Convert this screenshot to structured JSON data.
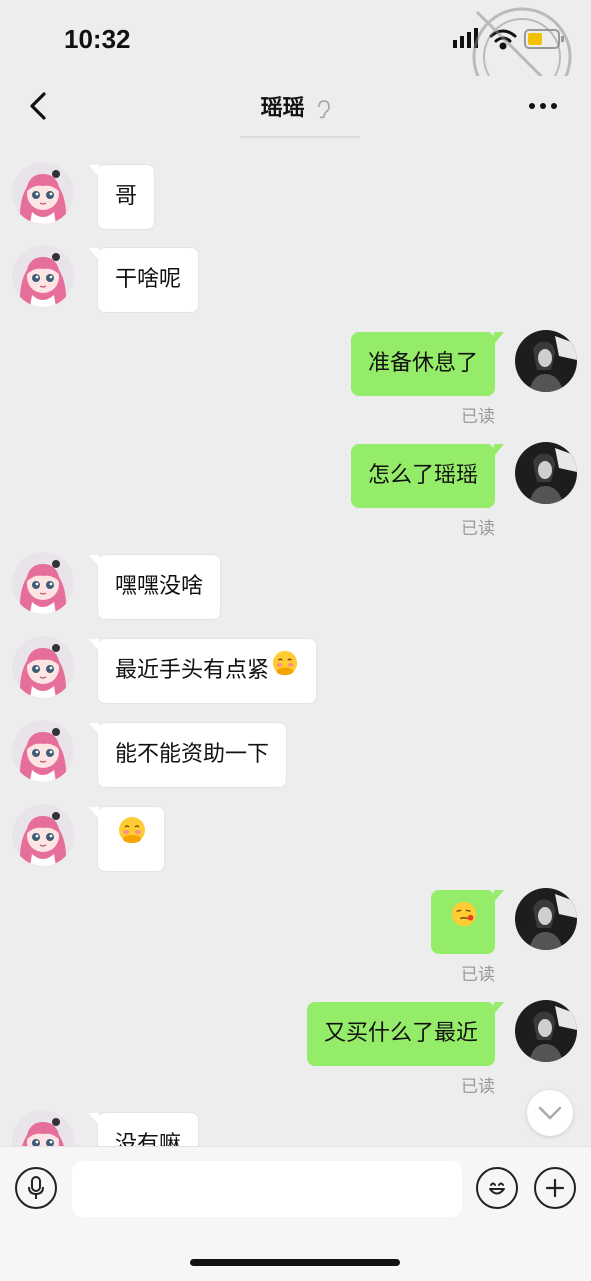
{
  "status_bar": {
    "time": "10:32",
    "icons": [
      "signal-icon",
      "wifi-icon",
      "battery-icon"
    ]
  },
  "nav": {
    "title": "瑶瑶",
    "ear_icon": "ear-icon",
    "back_icon": "back-chevron-icon",
    "more_icon": "more-icon"
  },
  "messages": [
    {
      "side": "left",
      "text": "哥"
    },
    {
      "side": "left",
      "text": "干啥呢"
    },
    {
      "side": "right",
      "text": "准备休息了",
      "status": "已读"
    },
    {
      "side": "right",
      "text": "怎么了瑶瑶",
      "status": "已读"
    },
    {
      "side": "left",
      "text": "嘿嘿没啥"
    },
    {
      "side": "left",
      "text": "最近手头有点紧",
      "emoji": "shy-hug-emoji"
    },
    {
      "side": "left",
      "text": "能不能资助一下"
    },
    {
      "side": "left",
      "text": "",
      "emoji": "shy-hug-emoji"
    },
    {
      "side": "right",
      "text": "",
      "emoji": "dizzy-face-emoji",
      "status": "已读"
    },
    {
      "side": "right",
      "text": "又买什么了最近",
      "status": "已读"
    },
    {
      "side": "left",
      "text": "没有嘛"
    }
  ],
  "input_bar": {
    "placeholder": "",
    "voice_icon": "voice-icon",
    "emoji_icon": "emoji-icon",
    "plus_icon": "plus-icon"
  },
  "colors": {
    "background": "#ededed",
    "sent_bubble": "#95ec69",
    "received_bubble": "#ffffff"
  }
}
